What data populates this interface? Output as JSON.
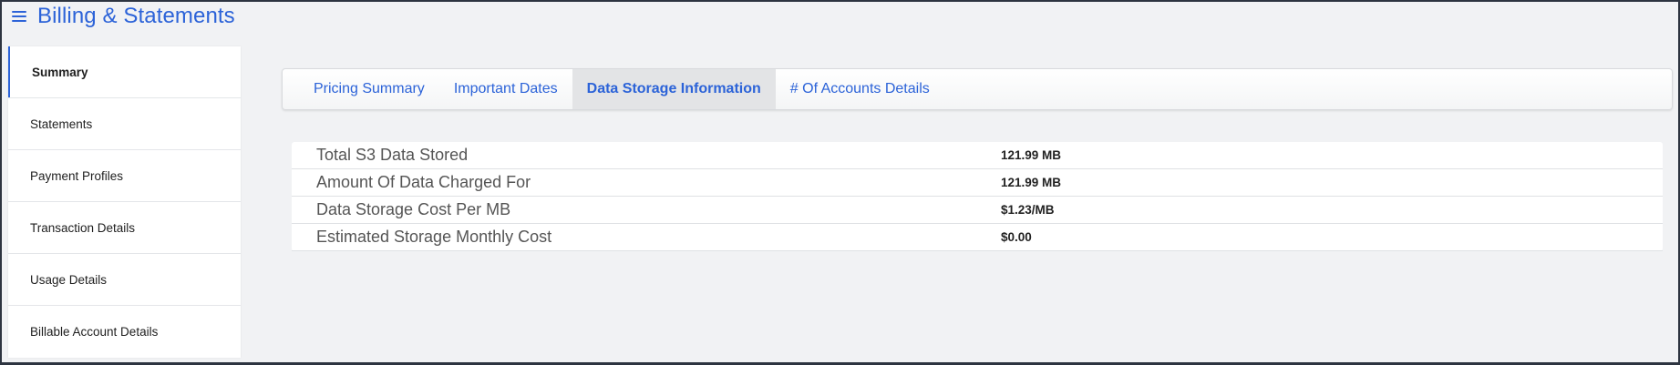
{
  "header": {
    "title": "Billing & Statements",
    "menu_icon": "hamburger-menu-icon"
  },
  "sidebar": {
    "items": [
      {
        "label": "Summary",
        "active": true
      },
      {
        "label": "Statements"
      },
      {
        "label": "Payment Profiles"
      },
      {
        "label": "Transaction Details"
      },
      {
        "label": "Usage Details"
      },
      {
        "label": "Billable Account Details"
      }
    ]
  },
  "tabs": [
    {
      "label": "Pricing Summary"
    },
    {
      "label": "Important Dates"
    },
    {
      "label": "Data Storage Information",
      "active": true
    },
    {
      "label": "# Of Accounts Details"
    }
  ],
  "storage_info": [
    {
      "label": "Total S3 Data Stored",
      "value": "121.99 MB"
    },
    {
      "label": "Amount Of Data Charged For",
      "value": "121.99 MB"
    },
    {
      "label": "Data Storage Cost Per MB",
      "value": "$1.23/MB"
    },
    {
      "label": "Estimated Storage Monthly Cost",
      "value": "$0.00"
    }
  ],
  "colors": {
    "accent": "#2c63d8",
    "background": "#f1f2f4",
    "frame": "#2d3440"
  }
}
